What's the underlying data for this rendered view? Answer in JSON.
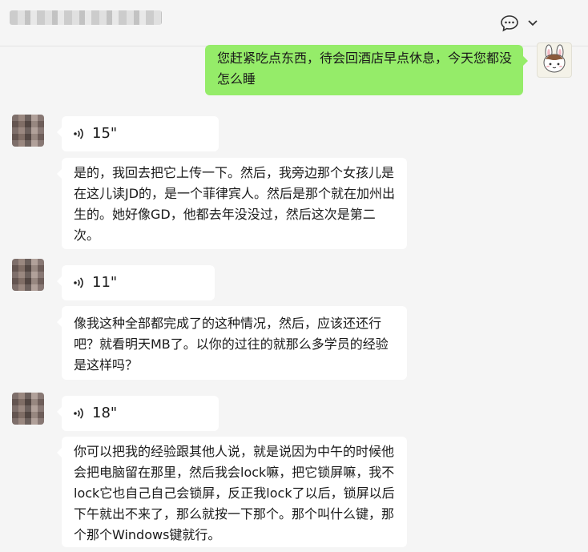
{
  "header": {
    "contact_name": "",
    "chat_icon": "chat-bubble-icon",
    "menu_icon": "chevron-down-icon"
  },
  "messages": [
    {
      "type": "text",
      "side": "right",
      "text": "您赶紧吃点东西，待会回酒店早点休息，今天您都没怎么睡"
    },
    {
      "type": "voice",
      "side": "left",
      "duration": "15\""
    },
    {
      "type": "text",
      "side": "left",
      "text": "是的，我回去把它上传一下。然后，我旁边那个女孩儿是在这儿读JD的，是一个菲律宾人。然后是那个就在加州出生的。她好像GD，他都去年没没过，然后这次是第二次。"
    },
    {
      "type": "voice",
      "side": "left",
      "duration": "11\""
    },
    {
      "type": "text",
      "side": "left",
      "text": "像我这种全部都完成了的这种情况，然后，应该还还行吧？就看明天MB了。以你的过往的就那么多学员的经验是这样吗？"
    },
    {
      "type": "voice",
      "side": "left",
      "duration": "18\""
    },
    {
      "type": "text",
      "side": "left",
      "text": "你可以把我的经验跟其他人说，就是说因为中午的时候他会把电脑留在那里，然后我会lock嘛，把它锁屏嘛，我不lock它也自己自己会锁屏，反正我lock了以后，锁屏以后下午就出不来了，那么就按一下那个。那个叫什么键，那个那个Windows键就行。"
    }
  ],
  "colors": {
    "background": "#f5f5f5",
    "bubble_self": "#95ec69",
    "bubble_other": "#ffffff"
  }
}
